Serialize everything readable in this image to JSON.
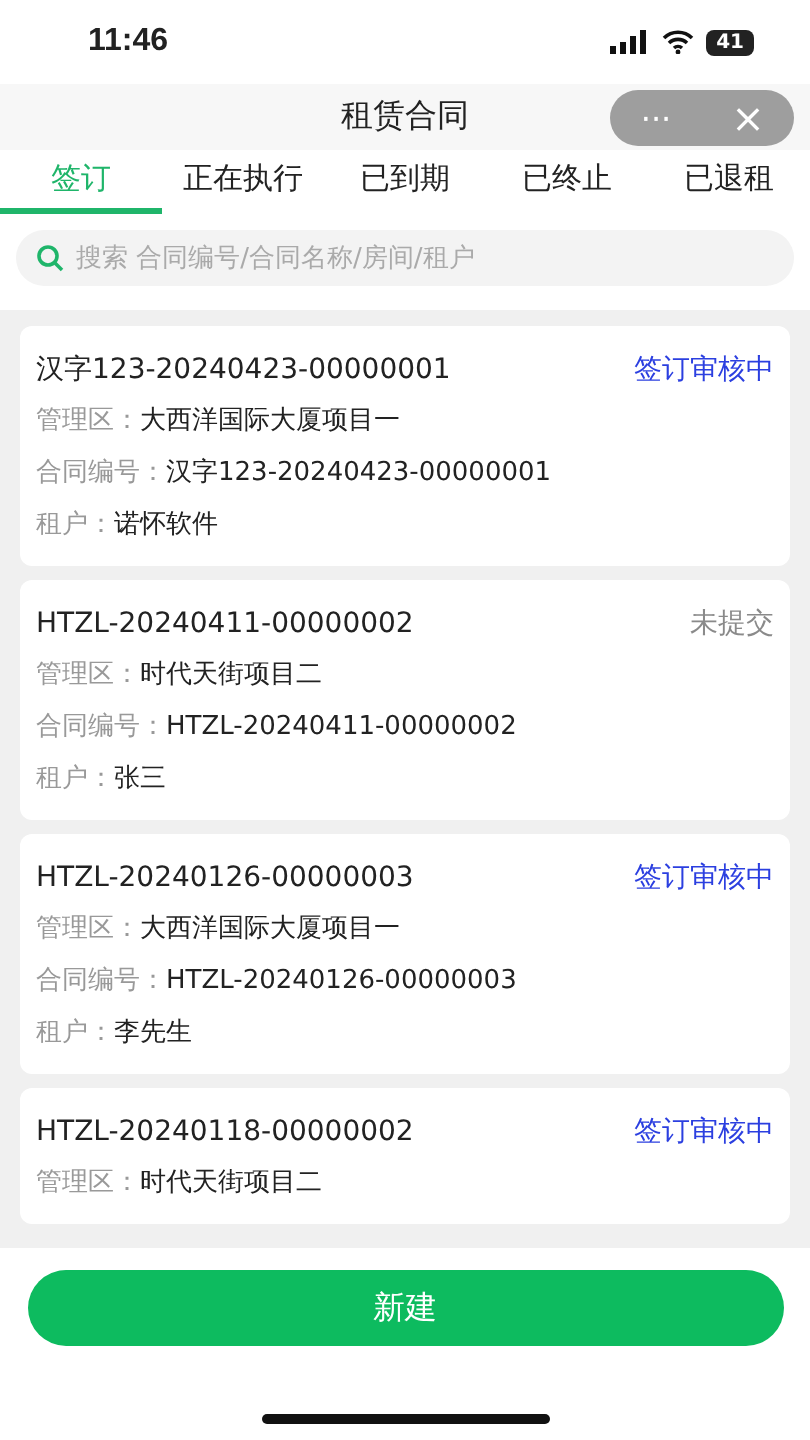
{
  "status_bar": {
    "time": "11:46",
    "battery": "41"
  },
  "header": {
    "title": "租赁合同",
    "more": "···",
    "close": "×"
  },
  "tabs": [
    {
      "label": "签订",
      "selected": true
    },
    {
      "label": "正在执行",
      "selected": false
    },
    {
      "label": "已到期",
      "selected": false
    },
    {
      "label": "已终止",
      "selected": false
    },
    {
      "label": "已退租",
      "selected": false
    }
  ],
  "search": {
    "placeholder": "搜索 合同编号/合同名称/房间/租户"
  },
  "contracts": [
    {
      "code": "汉字123-20240423-00000001",
      "status": "签订审核中",
      "color": "#2b3fe0",
      "fields": [
        {
          "label": "管理区：",
          "value": "大西洋国际大厦项目一"
        },
        {
          "label": "合同编号：",
          "value": "汉字123-20240423-00000001"
        },
        {
          "label": "租户：",
          "value": "诺怀软件"
        }
      ]
    },
    {
      "code": "HTZL-20240411-00000002",
      "status": "未提交",
      "color": "#8a8a8a",
      "fields": [
        {
          "label": "管理区：",
          "value": "时代天街项目二"
        },
        {
          "label": "合同编号：",
          "value": "HTZL-20240411-00000002"
        },
        {
          "label": "租户：",
          "value": "张三"
        }
      ]
    },
    {
      "code": "HTZL-20240126-00000003",
      "status": "签订审核中",
      "color": "#2b3fe0",
      "fields": [
        {
          "label": "管理区：",
          "value": "大西洋国际大厦项目一"
        },
        {
          "label": "合同编号：",
          "value": "HTZL-20240126-00000003"
        },
        {
          "label": "租户：",
          "value": "李先生"
        }
      ]
    },
    {
      "code": "HTZL-20240118-00000002",
      "status": "签订审核中",
      "color": "#2b3fe0",
      "fields": [
        {
          "label": "管理区：",
          "value": "时代天街项目二"
        }
      ]
    }
  ],
  "new_button": "新建"
}
